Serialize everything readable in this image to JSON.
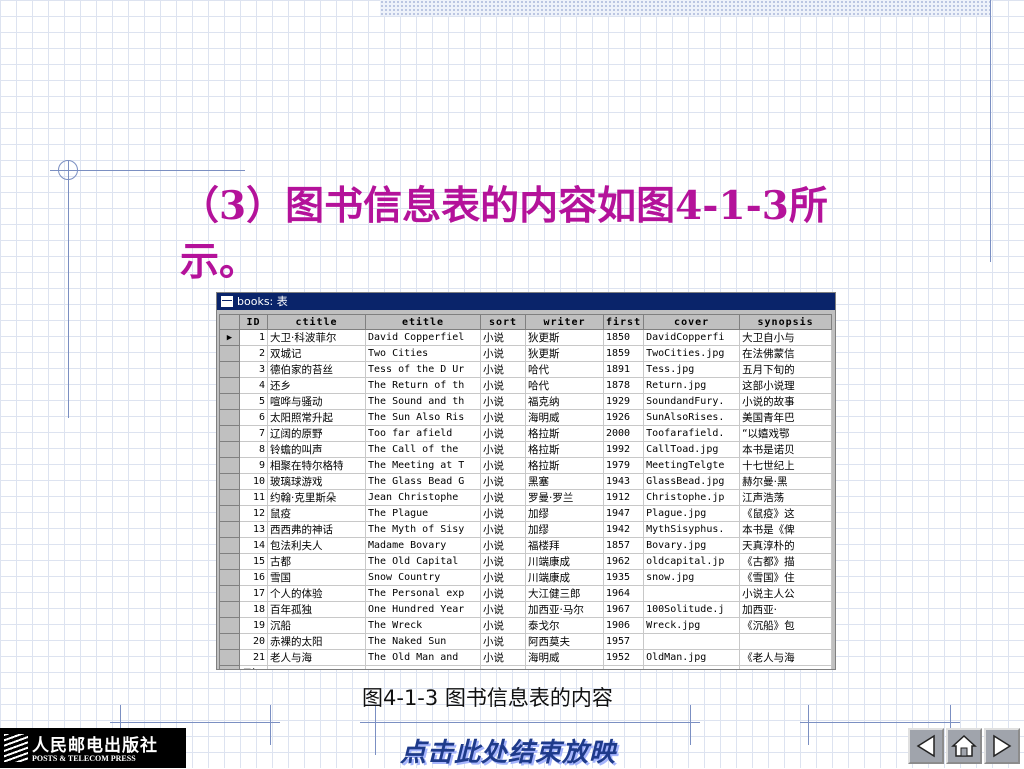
{
  "slide": {
    "title_line1": "（3）图书信息表的内容如图4-1-3所",
    "title_line2": "示。",
    "caption": "图4-1-3  图书信息表的内容",
    "end_show": "点击此处结束放映",
    "publisher_cn": "人民邮电出版社",
    "publisher_en": "POSTS & TELECOM PRESS"
  },
  "window": {
    "title": "books: 表"
  },
  "table": {
    "columns": [
      "ID",
      "ctitle",
      "etitle",
      "sort",
      "writer",
      "first",
      "cover",
      "synopsis"
    ],
    "rows": [
      [
        "1",
        "大卫·科波菲尔",
        "David Copperfiel",
        "小说",
        "狄更斯",
        "1850",
        "DavidCopperfi",
        "大卫自小与"
      ],
      [
        "2",
        "双城记",
        "Two Cities",
        "小说",
        "狄更斯",
        "1859",
        "TwoCities.jpg",
        "在法佛蒙信"
      ],
      [
        "3",
        "德伯家的苔丝",
        "Tess of the D Ur",
        "小说",
        "哈代",
        "1891",
        "Tess.jpg",
        "五月下旬的"
      ],
      [
        "4",
        "还乡",
        "The Return of th",
        "小说",
        "哈代",
        "1878",
        "Return.jpg",
        "这部小说理"
      ],
      [
        "5",
        "喧哗与骚动",
        "The Sound and th",
        "小说",
        "福克纳",
        "1929",
        "SoundandFury.",
        "小说的故事"
      ],
      [
        "6",
        "太阳照常升起",
        "The Sun Also Ris",
        "小说",
        "海明威",
        "1926",
        "SunAlsoRises.",
        "美国青年巴"
      ],
      [
        "7",
        "辽阔的原野",
        "Too far afield",
        "小说",
        "格拉斯",
        "2000",
        "Toofarafield.",
        "“以嬉戏鄂"
      ],
      [
        "8",
        "铃蟾的叫声",
        "The Call of the",
        "小说",
        "格拉斯",
        "1992",
        "CallToad.jpg",
        "本书是诺贝"
      ],
      [
        "9",
        "相聚在特尔格特",
        "The Meeting at T",
        "小说",
        "格拉斯",
        "1979",
        "MeetingTelgte",
        "十七世纪上"
      ],
      [
        "10",
        "玻璃球游戏",
        "The Glass Bead G",
        "小说",
        "黑塞",
        "1943",
        "GlassBead.jpg",
        "赫尔曼·黑"
      ],
      [
        "11",
        "约翰·克里斯朵",
        "Jean Christophe",
        "小说",
        "罗曼·罗兰",
        "1912",
        "Christophe.jp",
        "江声浩荡"
      ],
      [
        "12",
        "鼠疫",
        "The Plague",
        "小说",
        "加缪",
        "1947",
        "Plague.jpg",
        "《鼠疫》这"
      ],
      [
        "13",
        "西西弗的神话",
        "The Myth of Sisy",
        "小说",
        "加缪",
        "1942",
        "MythSisyphus.",
        "本书是《俾"
      ],
      [
        "14",
        "包法利夫人",
        "Madame Bovary",
        "小说",
        "福楼拜",
        "1857",
        "Bovary.jpg",
        "天真淳朴的"
      ],
      [
        "15",
        "古都",
        "The Old Capital",
        "小说",
        "川端康成",
        "1962",
        "oldcapital.jp",
        "《古都》描"
      ],
      [
        "16",
        "雪国",
        "Snow Country",
        "小说",
        "川端康成",
        "1935",
        "snow.jpg",
        "《雪国》住"
      ],
      [
        "17",
        "个人的体验",
        "The Personal exp",
        "小说",
        "大江健三郎",
        "1964",
        "",
        "小说主人公"
      ],
      [
        "18",
        "百年孤独",
        "One Hundred Year",
        "小说",
        "加西亚·马尔",
        "1967",
        "100Solitude.j",
        "加西亚·"
      ],
      [
        "19",
        "沉船",
        "The Wreck",
        "小说",
        "泰戈尔",
        "1906",
        "Wreck.jpg",
        "《沉船》包"
      ],
      [
        "20",
        "赤裸的太阳",
        "The Naked Sun",
        "小说",
        "阿西莫夫",
        "1957",
        "",
        ""
      ],
      [
        "21",
        "老人与海",
        "The Old Man and",
        "小说",
        "海明威",
        "1952",
        "OldMan.jpg",
        "《老人与海"
      ]
    ],
    "new_row_label": "号）"
  },
  "icons": [
    "table-icon",
    "record-pointer-icon",
    "new-record-icon",
    "prev-slide-icon",
    "home-icon",
    "next-slide-icon"
  ],
  "colors": {
    "title": "#b4129a",
    "window_title_bg": "#0a246a",
    "end_show": "#1e3a8a"
  }
}
